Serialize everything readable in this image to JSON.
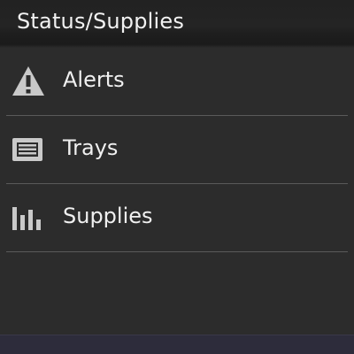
{
  "header": {
    "title": "Status/Supplies"
  },
  "menu": {
    "items": [
      {
        "label": "Alerts",
        "icon": "warning-triangle-icon"
      },
      {
        "label": "Trays",
        "icon": "tray-icon"
      },
      {
        "label": "Supplies",
        "icon": "supplies-bars-icon"
      }
    ]
  },
  "colors": {
    "background": "#2c2c2c",
    "text": "#f0f0f0",
    "icon": "#c9c9c9",
    "divider": "#5a5a5a",
    "bottom_bar": "#2d2c3b"
  }
}
